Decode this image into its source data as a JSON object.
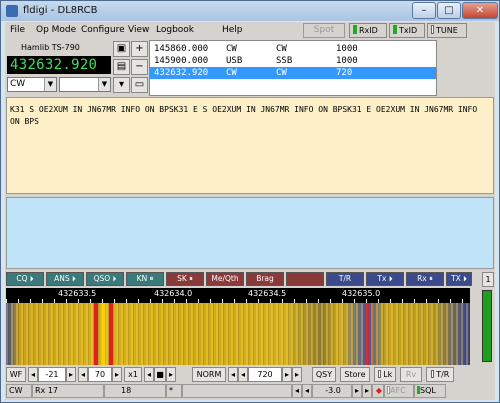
{
  "window": {
    "title": "fldigi - DL8RCB",
    "min": "–",
    "max": "□",
    "close": "✕"
  },
  "menu": {
    "file": "File",
    "op_mode": "Op Mode",
    "configure": "Configure",
    "view": "View",
    "logbook": "Logbook",
    "help": "Help"
  },
  "toolbar": {
    "spot": "Spot",
    "rxid": "RxID",
    "txid": "TxID",
    "tune": "TUNE"
  },
  "rig": {
    "name": "Hamlib TS-790",
    "frequency": "432632.920",
    "mode": "CW",
    "bandwidth": ""
  },
  "freq_list": [
    {
      "freq": "145860.000",
      "mode": "CW",
      "submode": "CW",
      "width": "1000"
    },
    {
      "freq": "145900.000",
      "mode": "USB",
      "submode": "SSB",
      "width": "1000"
    },
    {
      "freq": "432632.920",
      "mode": "CW",
      "submode": "CW",
      "width": "720"
    }
  ],
  "rx_text": "K31 S OE2XUM IN JN67MR INFO ON BPSK31 E S OE2XUM IN JN67MR INFO ON BPSK31 E OE2XUM IN JN67MR INFO ON BPS",
  "macros": [
    "CQ ⏵",
    "ANS ⏵",
    "QSO ⏵",
    "KN ⏸",
    "SK ⏸",
    "Me/Qth",
    "Brag",
    "",
    "T/R",
    "Tx ⏵",
    "Rx ⏸",
    "TX ⏵"
  ],
  "macro_page": "1",
  "scale": {
    "labels": [
      "432633.5",
      "432634.0",
      "432634.5",
      "432635.0"
    ]
  },
  "controls": {
    "wf": "WF",
    "ref": "-21",
    "range": "70",
    "zoom": "x1",
    "speed": "NORM",
    "carrier": "720",
    "qsy": "QSY",
    "store": "Store",
    "lk": "Lk",
    "rv": "Rv",
    "tr": "T/R"
  },
  "status": {
    "mode": "CW",
    "rx": "Rx 17",
    "wpm": "18",
    "star": "*",
    "sn": "-3.0",
    "afc": "AFC",
    "sql": "SQL"
  },
  "colors": {
    "macro_green": "#3a7a7a",
    "macro_red": "#8a3a3a",
    "macro_blue": "#3a4a8a",
    "freq_green": "#3fdf5f",
    "waterfall_red": "#e02020"
  }
}
